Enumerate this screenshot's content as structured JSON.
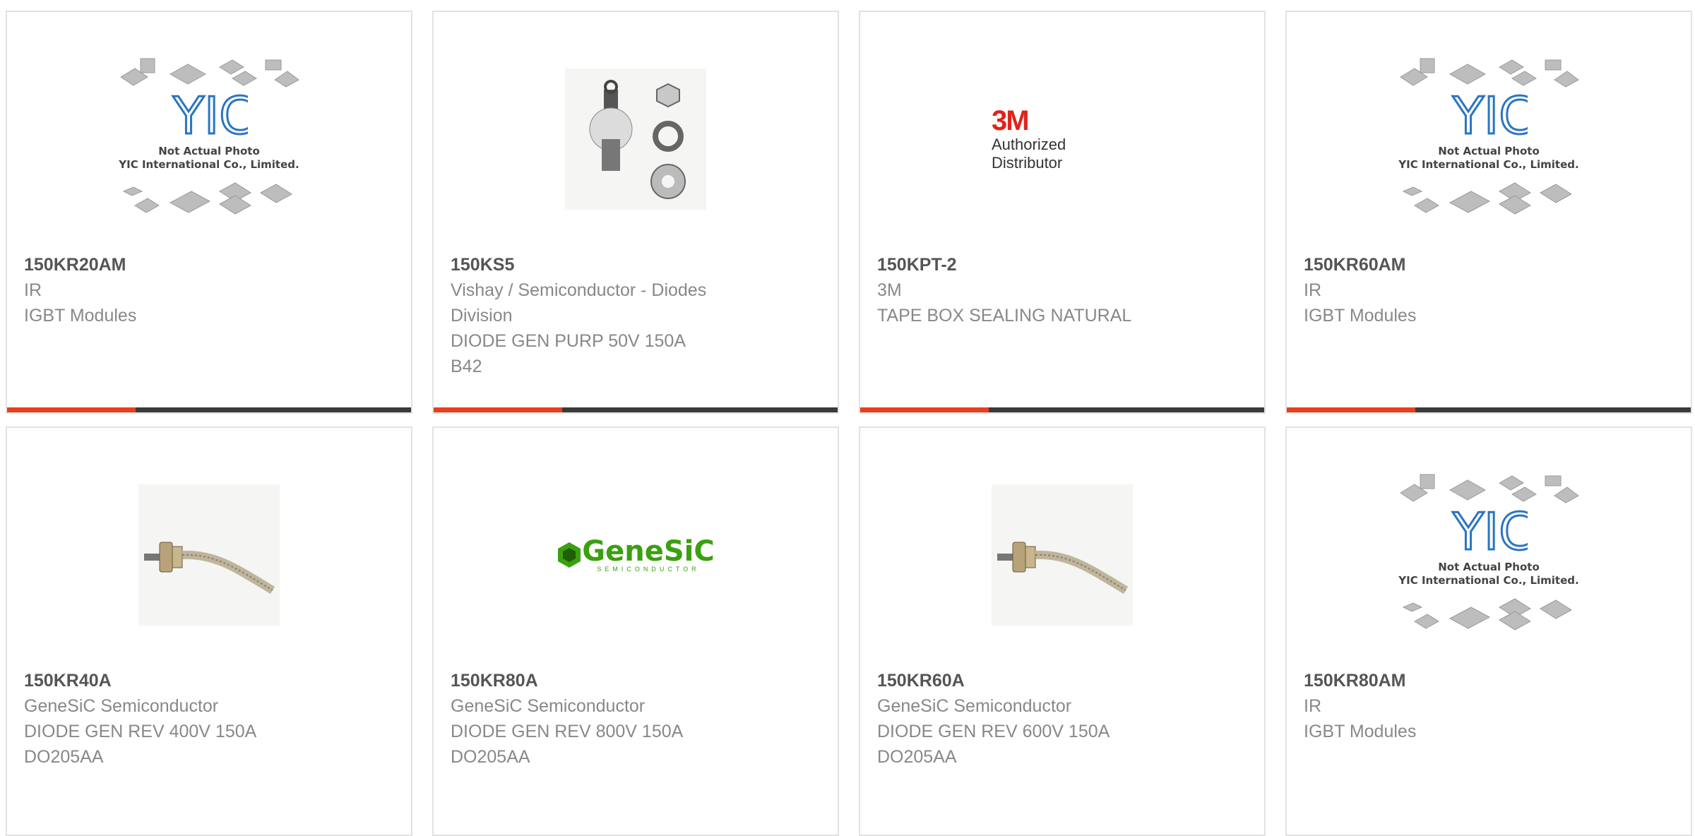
{
  "products": [
    {
      "part": "150KR20AM",
      "lines": [
        "IR",
        "IGBT Modules"
      ],
      "image": "yic-placeholder"
    },
    {
      "part": "150KS5",
      "lines": [
        "Vishay / Semiconductor - Diodes",
        "Division",
        "DIODE GEN PURP 50V 150A",
        "B42"
      ],
      "image": "stud-diode-with-nuts"
    },
    {
      "part": "150KPT-2",
      "lines": [
        "3M",
        "TAPE BOX SEALING NATURAL"
      ],
      "image": "3m-logo"
    },
    {
      "part": "150KR60AM",
      "lines": [
        "IR",
        "IGBT Modules"
      ],
      "image": "yic-placeholder"
    },
    {
      "part": "150KR40A",
      "lines": [
        "GeneSiC Semiconductor",
        "DIODE GEN REV 400V 150A",
        "DO205AA"
      ],
      "image": "stud-diode-braided"
    },
    {
      "part": "150KR80A",
      "lines": [
        "GeneSiC Semiconductor",
        "DIODE GEN REV 800V 150A",
        "DO205AA"
      ],
      "image": "genesic-logo"
    },
    {
      "part": "150KR60A",
      "lines": [
        "GeneSiC Semiconductor",
        "DIODE GEN REV 600V 150A",
        "DO205AA"
      ],
      "image": "stud-diode-braided"
    },
    {
      "part": "150KR80AM",
      "lines": [
        "IR",
        "IGBT Modules"
      ],
      "image": "yic-placeholder"
    }
  ],
  "yic": {
    "line1": "Not Actual Photo",
    "line2": "YIC International Co., Limited.",
    "logo": "YIC"
  },
  "threem": {
    "logo": "3M",
    "caption": "Authorized Distributor"
  },
  "genesic": {
    "logo": "GeneSiC",
    "sub": "SEMICONDUCTOR"
  },
  "colors": {
    "accent": "#e8401c",
    "bar": "#3a3a3a",
    "part": "#555555",
    "text": "#888888"
  }
}
